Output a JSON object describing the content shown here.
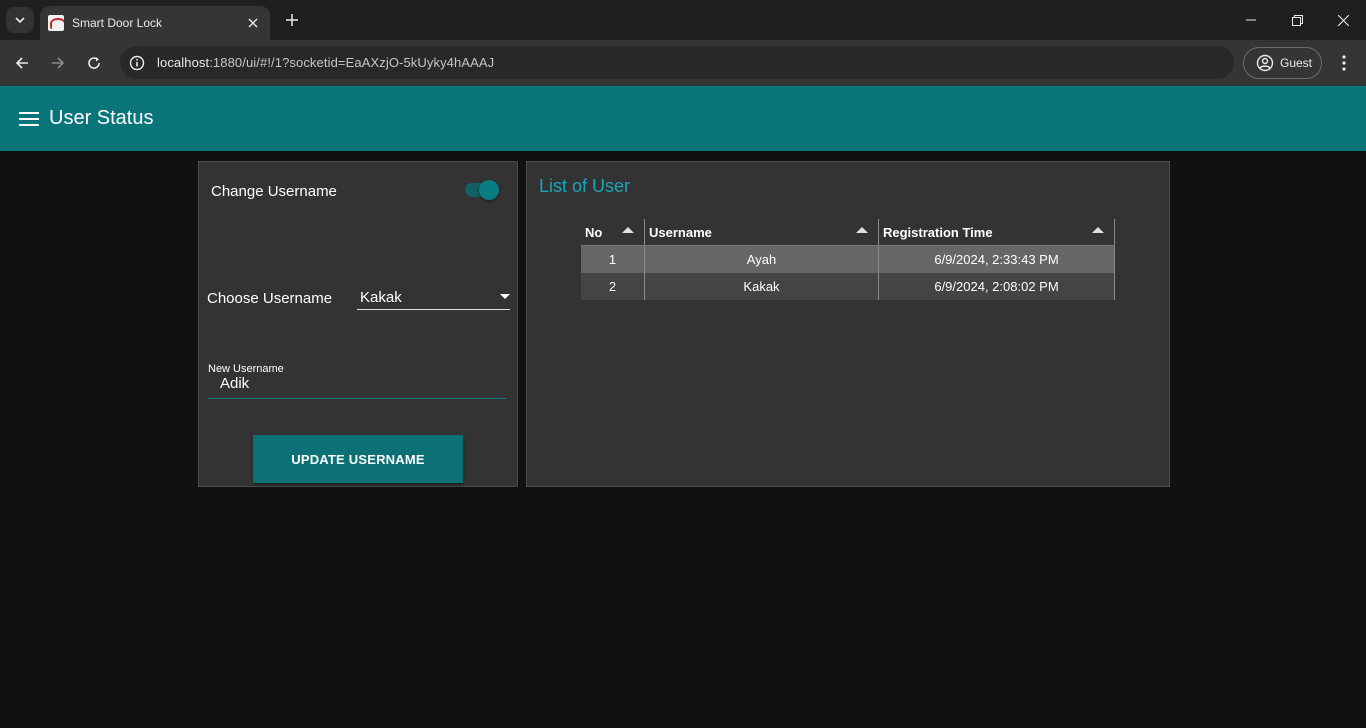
{
  "browser": {
    "tab_title": "Smart Door Lock",
    "url_host": "localhost",
    "url_rest": ":1880/ui/#!/1?socketid=EaAXzjO-5kUyky4hAAAJ",
    "profile_label": "Guest"
  },
  "app": {
    "title": "User Status",
    "accent_color": "#097479"
  },
  "change_card": {
    "toggle_label": "Change Username",
    "toggle_on": true,
    "choose_label": "Choose Username",
    "selected_user": "Kakak",
    "new_username_label": "New Username",
    "new_username_value": "Adik",
    "update_button": "UPDATE USERNAME"
  },
  "user_list": {
    "title": "List of User",
    "columns": [
      "No",
      "Username",
      "Registration Time"
    ],
    "rows": [
      {
        "no": "1",
        "username": "Ayah",
        "time": "6/9/2024, 2:33:43 PM"
      },
      {
        "no": "2",
        "username": "Kakak",
        "time": "6/9/2024, 2:08:02 PM"
      }
    ]
  }
}
